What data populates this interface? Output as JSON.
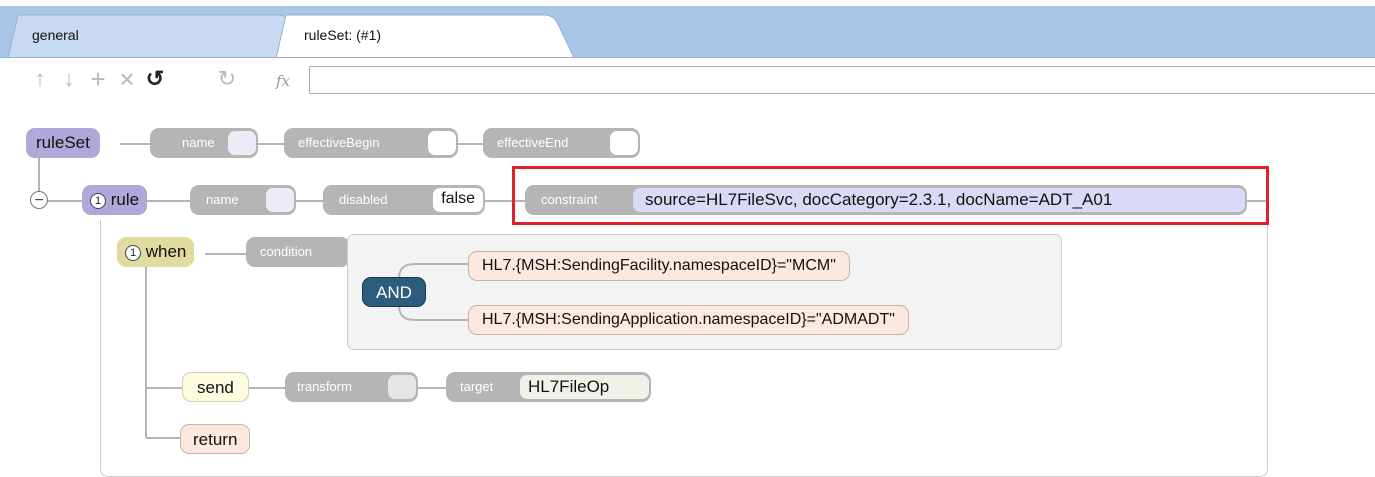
{
  "tabs": [
    {
      "label": "general"
    },
    {
      "label": "ruleSet: (#1)"
    }
  ],
  "toolbar": {
    "icons": [
      "arrow-up-icon",
      "arrow-down-icon",
      "plus-icon",
      "close-icon",
      "undo-icon",
      "redo-icon",
      "fx-icon"
    ],
    "glyphs": {
      "up": "↑",
      "down": "↓",
      "plus": "+",
      "close": "×",
      "undo": "↺",
      "redo": "↻",
      "fx": "fx"
    },
    "expression_value": ""
  },
  "ruleSet": {
    "label": "ruleSet",
    "name_label": "name",
    "effectiveBegin_label": "effectiveBegin",
    "effectiveEnd_label": "effectiveEnd"
  },
  "rule": {
    "collapse_glyph": "−",
    "count": "1",
    "label": "rule",
    "name_label": "name",
    "disabled_label": "disabled",
    "disabled_value": "false",
    "constraint_label": "constraint",
    "constraint_value": "source=HL7FileSvc, docCategory=2.3.1, docName=ADT_A01"
  },
  "when": {
    "count": "1",
    "label": "when",
    "condition_label": "condition",
    "operator": "AND",
    "conditions": [
      "HL7.{MSH:SendingFacility.namespaceID}=\"MCM\"",
      "HL7.{MSH:SendingApplication.namespaceID}=\"ADMADT\""
    ]
  },
  "send": {
    "label": "send",
    "transform_label": "transform",
    "target_label": "target",
    "target_value": "HL7FileOp"
  },
  "return": {
    "label": "return"
  },
  "colors": {
    "tab_strip": "#a9c5e6",
    "ruleset": "#b0a8d8",
    "rule": "#b0a8d8",
    "when": "#e0dca0",
    "send": "#fdfbe0",
    "return": "#fbe8de",
    "and_operator": "#2c5d7c",
    "highlight": "#e3202b"
  }
}
